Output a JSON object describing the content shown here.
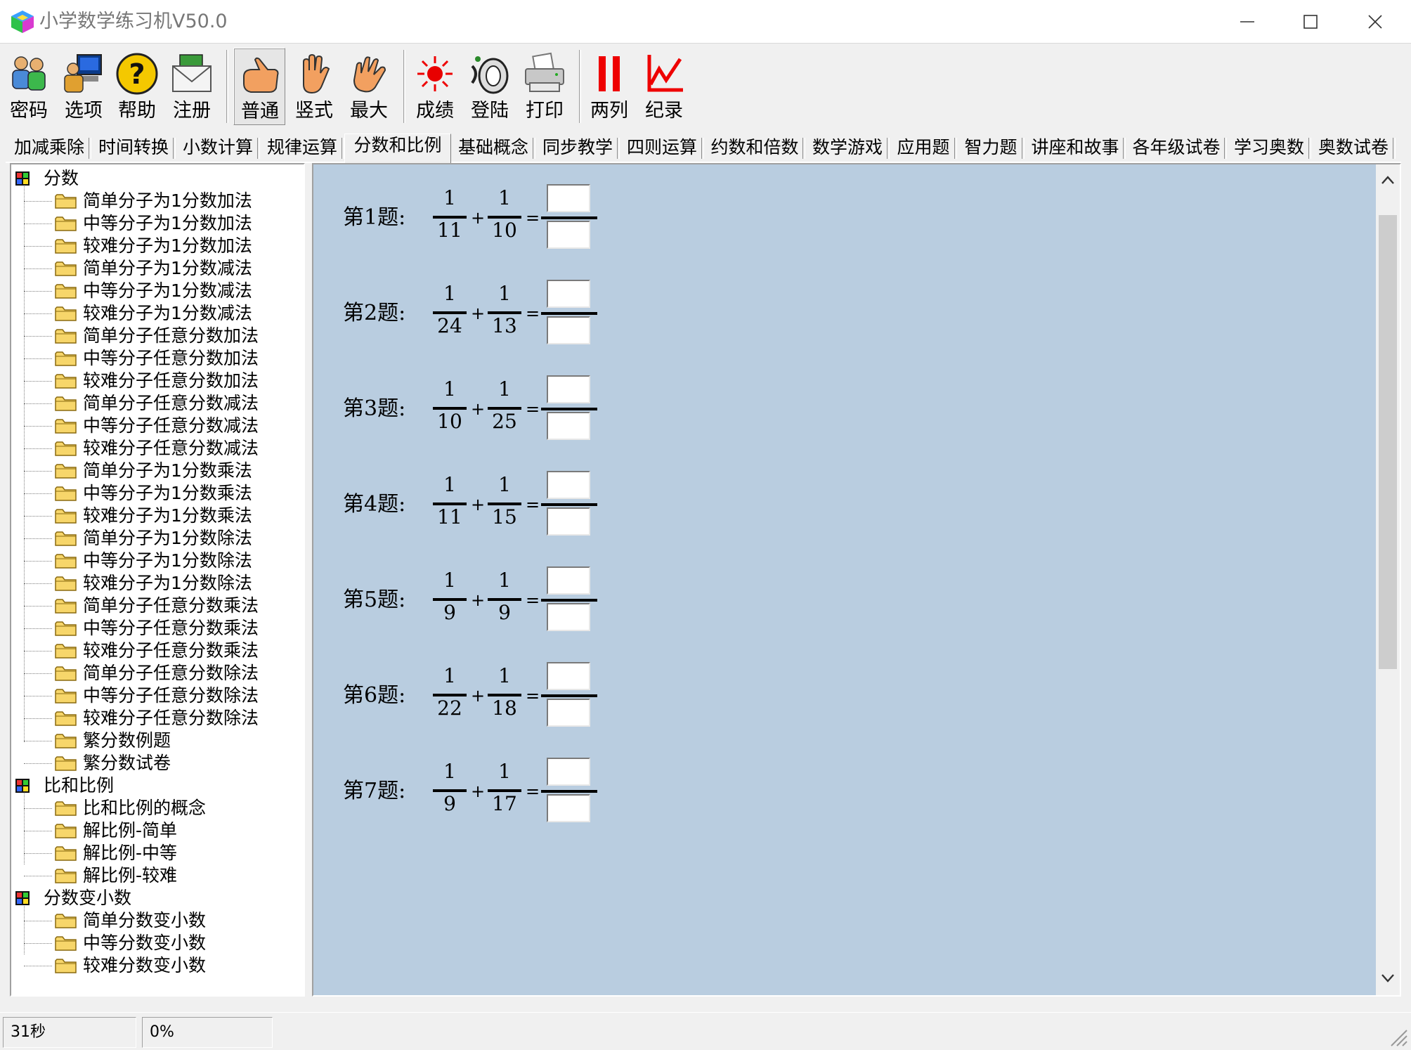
{
  "window": {
    "title": "小学数学练习机V50.0"
  },
  "toolbar": {
    "groups": [
      [
        {
          "label": "密码",
          "icon": "users-icon"
        },
        {
          "label": "选项",
          "icon": "computer-user-icon"
        },
        {
          "label": "帮助",
          "icon": "help-icon"
        },
        {
          "label": "注册",
          "icon": "mail-icon"
        }
      ],
      [
        {
          "label": "普通",
          "icon": "hand-point-icon",
          "pressed": true
        },
        {
          "label": "竖式",
          "icon": "hand-open-icon"
        },
        {
          "label": "最大",
          "icon": "hand-wave-icon"
        }
      ],
      [
        {
          "label": "成绩",
          "icon": "red-light-icon"
        },
        {
          "label": "登陆",
          "icon": "horn-icon"
        },
        {
          "label": "打印",
          "icon": "printer-icon"
        }
      ],
      [
        {
          "label": "两列",
          "icon": "two-columns-icon"
        },
        {
          "label": "纪录",
          "icon": "chart-line-icon"
        }
      ]
    ]
  },
  "tabs": [
    "加减乘除",
    "时间转换",
    "小数计算",
    "规律运算",
    "分数和比例",
    "基础概念",
    "同步教学",
    "四则运算",
    "约数和倍数",
    "数学游戏",
    "应用题",
    "智力题",
    "讲座和故事",
    "各年级试卷",
    "学习奥数",
    "奥数试卷"
  ],
  "active_tab": "分数和比例",
  "tree": [
    {
      "label": "分数",
      "children": [
        "简单分子为1分数加法",
        "中等分子为1分数加法",
        "较难分子为1分数加法",
        "简单分子为1分数减法",
        "中等分子为1分数减法",
        "较难分子为1分数减法",
        "简单分子任意分数加法",
        "中等分子任意分数加法",
        "较难分子任意分数加法",
        "简单分子任意分数减法",
        "中等分子任意分数减法",
        "较难分子任意分数减法",
        "简单分子为1分数乘法",
        "中等分子为1分数乘法",
        "较难分子为1分数乘法",
        "简单分子为1分数除法",
        "中等分子为1分数除法",
        "较难分子为1分数除法",
        "简单分子任意分数乘法",
        "中等分子任意分数乘法",
        "较难分子任意分数乘法",
        "简单分子任意分数除法",
        "中等分子任意分数除法",
        "较难分子任意分数除法",
        "繁分数例题",
        "繁分数试卷"
      ]
    },
    {
      "label": "比和比例",
      "children": [
        "比和比例的概念",
        "解比例-简单",
        "解比例-中等",
        "解比例-较难"
      ]
    },
    {
      "label": "分数变小数",
      "children": [
        "简单分数变小数",
        "中等分数变小数",
        "较难分数变小数"
      ]
    }
  ],
  "problems": [
    {
      "label": "第1题:",
      "a_num": "1",
      "a_den": "11",
      "op": "+",
      "b_num": "1",
      "b_den": "10",
      "eq": "=",
      "answer_num": "",
      "answer_den": ""
    },
    {
      "label": "第2题:",
      "a_num": "1",
      "a_den": "24",
      "op": "+",
      "b_num": "1",
      "b_den": "13",
      "eq": "=",
      "answer_num": "",
      "answer_den": ""
    },
    {
      "label": "第3题:",
      "a_num": "1",
      "a_den": "10",
      "op": "+",
      "b_num": "1",
      "b_den": "25",
      "eq": "=",
      "answer_num": "",
      "answer_den": ""
    },
    {
      "label": "第4题:",
      "a_num": "1",
      "a_den": "11",
      "op": "+",
      "b_num": "1",
      "b_den": "15",
      "eq": "=",
      "answer_num": "",
      "answer_den": ""
    },
    {
      "label": "第5题:",
      "a_num": "1",
      "a_den": "9",
      "op": "+",
      "b_num": "1",
      "b_den": "9",
      "eq": "=",
      "answer_num": "",
      "answer_den": ""
    },
    {
      "label": "第6题:",
      "a_num": "1",
      "a_den": "22",
      "op": "+",
      "b_num": "1",
      "b_den": "18",
      "eq": "=",
      "answer_num": "",
      "answer_den": ""
    },
    {
      "label": "第7题:",
      "a_num": "1",
      "a_den": "9",
      "op": "+",
      "b_num": "1",
      "b_den": "17",
      "eq": "=",
      "answer_num": "",
      "answer_den": ""
    }
  ],
  "status": {
    "timer": "31秒",
    "progress": "0%"
  },
  "colors": {
    "problem_background": "#b9cde0",
    "window_background": "#f0f0f0"
  }
}
